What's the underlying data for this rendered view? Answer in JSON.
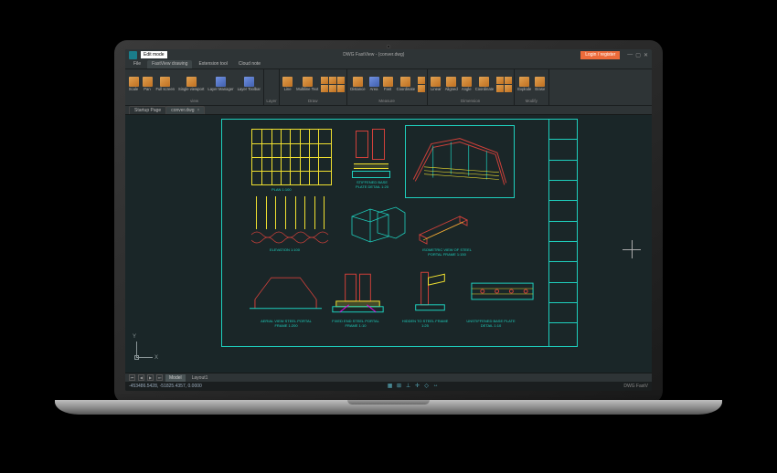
{
  "titlebar": {
    "edit_mode": "Edit mode",
    "title": "DWG FastView - (conver.dwg)",
    "login": "Login / register"
  },
  "menu": {
    "tabs": [
      "File",
      "FastView drawing",
      "Extension tool",
      "Cloud note"
    ],
    "active": 1
  },
  "ribbon": {
    "groups": [
      {
        "title": "view",
        "items": [
          "Scale",
          "Pan",
          "Full screen",
          "Single viewport",
          "Layer Manager",
          "Layer Toolbar"
        ]
      },
      {
        "title": "Layer",
        "items": []
      },
      {
        "title": "Draw",
        "items": [
          "Line",
          "Multiline Text"
        ]
      },
      {
        "title": "Measure",
        "items": [
          "Distance",
          "Area",
          "Fast",
          "Coordinate"
        ]
      },
      {
        "title": "Dimension",
        "items": [
          "Linear",
          "Aligned",
          "Angle",
          "Coordinate"
        ]
      },
      {
        "title": "Modify",
        "items": [
          "Explode",
          "Erase"
        ]
      }
    ]
  },
  "doctabs": {
    "tabs": [
      {
        "label": "Startup Page"
      },
      {
        "label": "conver.dwg"
      }
    ],
    "active": 1
  },
  "drawing": {
    "captions": {
      "plan": "PLAN  1:100",
      "base": "STIFFENED BASE PLATE DETAIL 1:20",
      "elev": "ELEVATION  1:100",
      "iso_label": "ISOMETRIC VIEW OF STEEL PORTAL FRAME 1:150",
      "det1": "AERIAL VIEW STEEL PORTAL FRAME 1:200",
      "det2": "FIXED END STEEL PORTAL FRAME 1:10",
      "det3": "HIDDEN TO STEEL FRAME 1:25",
      "det4": "UNSTIFFENED BASE PLATE DETAIL 1:10"
    }
  },
  "bottombar": {
    "model": "Model",
    "layout": "Layout1"
  },
  "status": {
    "coords": "-453486.5428, -51825.4357, 0.0000",
    "brand": "DWG FastV"
  }
}
